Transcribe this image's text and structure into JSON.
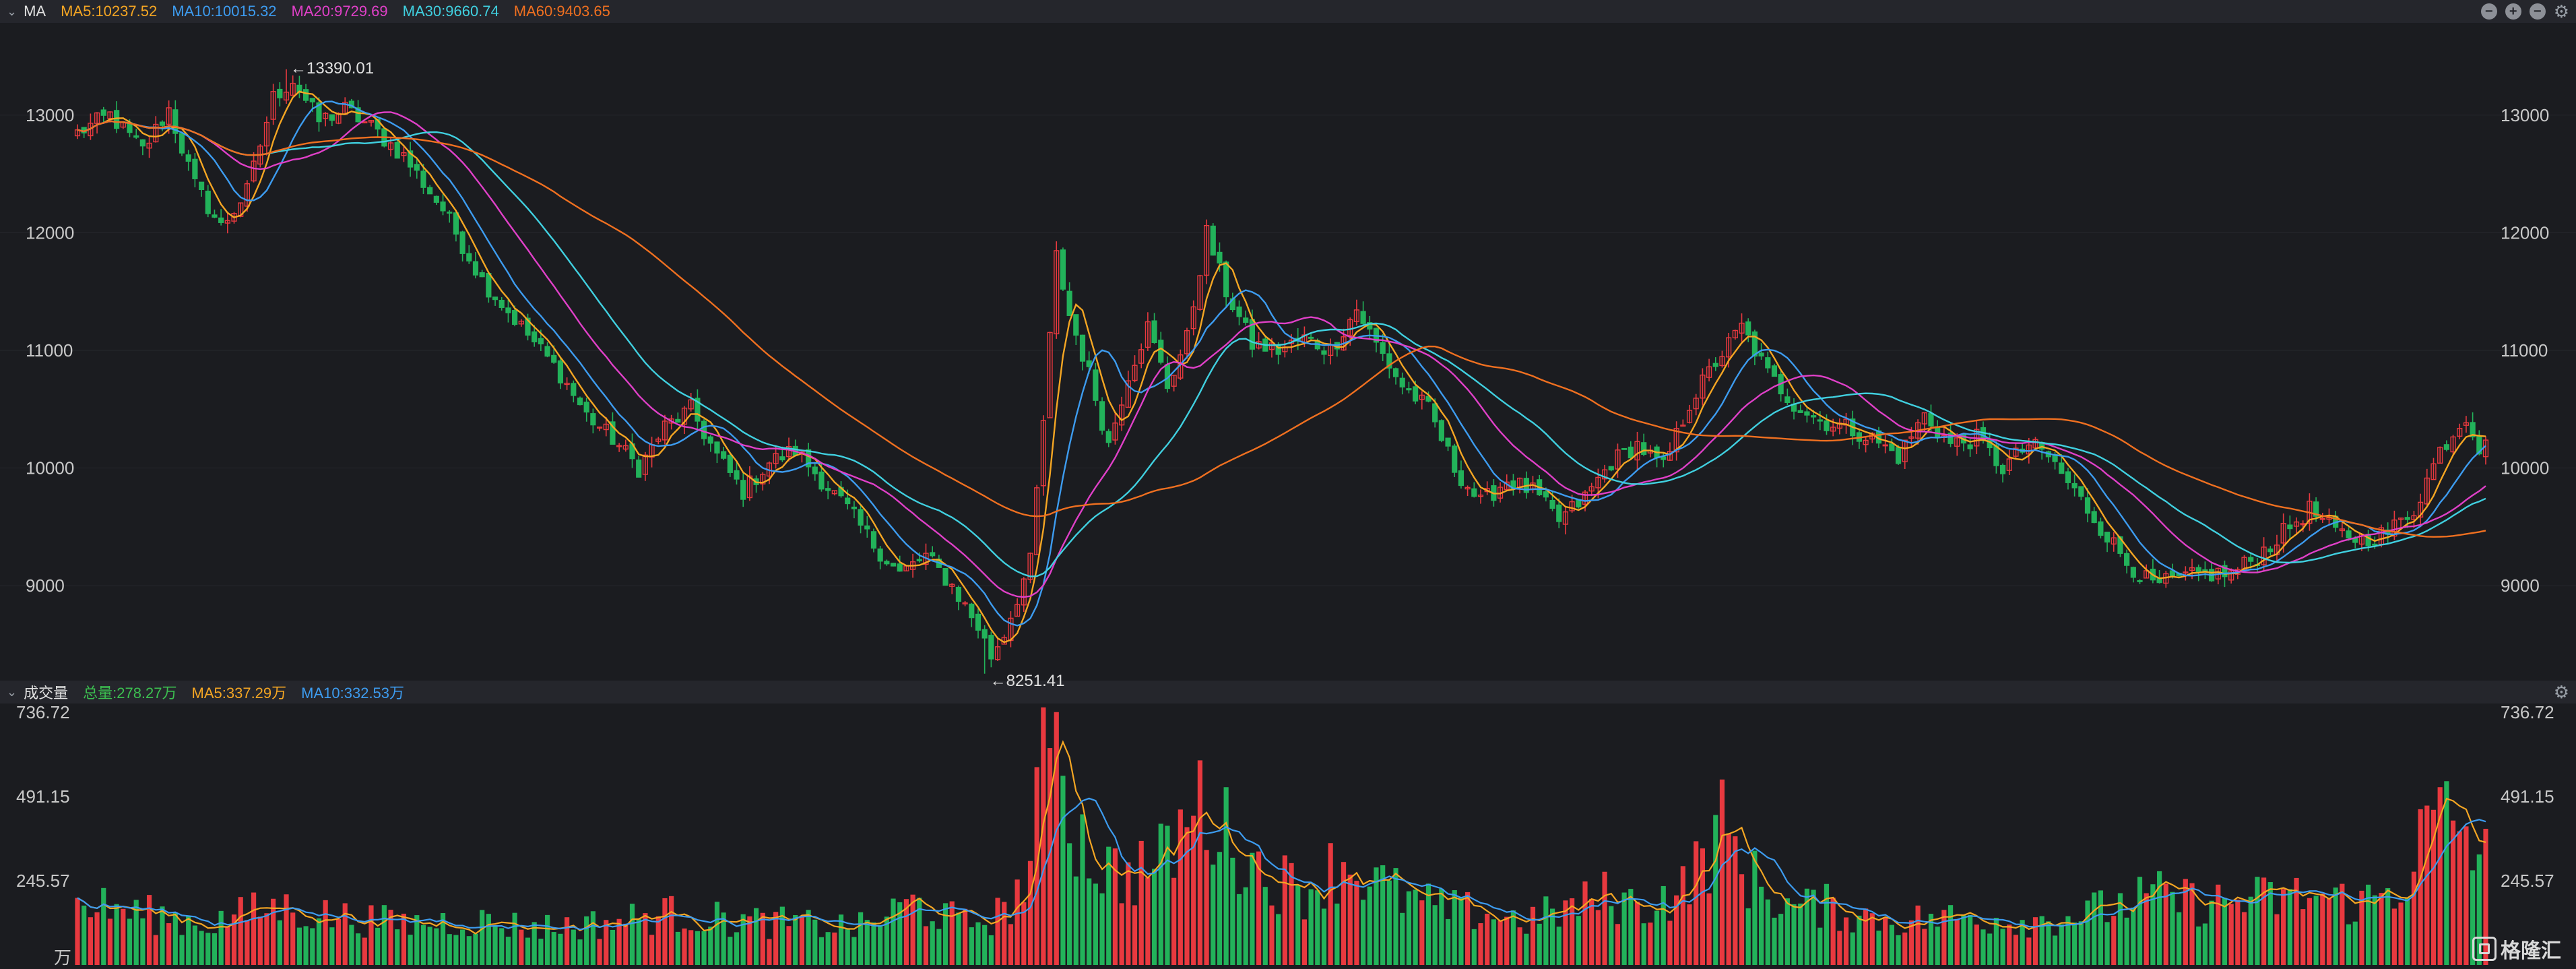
{
  "header": {
    "indicator": "MA",
    "ma5": "MA5:10237.52",
    "ma10": "MA10:10015.32",
    "ma20": "MA20:9729.69",
    "ma30": "MA30:9660.74",
    "ma60": "MA60:9403.65",
    "tools": [
      "minus-circle-icon",
      "plus-circle-icon",
      "minus-circle-icon",
      "gear-icon"
    ]
  },
  "volume_header": {
    "title": "成交量",
    "total": "总量:278.27万",
    "ma5": "MA5:337.29万",
    "ma10": "MA10:332.53万"
  },
  "colors": {
    "up": "#e8393f",
    "down": "#22b25a",
    "ma5": "#f5a623",
    "ma10": "#3d9cf0",
    "ma20": "#e040c8",
    "ma30": "#40d0e0",
    "ma60": "#f07020",
    "volume_total": "#3cc050"
  },
  "logo": {
    "text": "格隆汇"
  },
  "chart_data": [
    {
      "type": "candlestick",
      "yticks": [
        9000,
        10000,
        11000,
        12000,
        13000
      ],
      "ylim": [
        8250,
        13750
      ],
      "annotations": [
        {
          "label": "←13390.01",
          "value": 13390.01
        },
        {
          "label": "←8251.41",
          "value": 8251.41
        }
      ],
      "legend": [
        "MA5:10237.52",
        "MA10:10015.32",
        "MA20:9729.69",
        "MA30:9660.74",
        "MA60:9403.65"
      ],
      "anchors": [
        [
          0,
          12850
        ],
        [
          5,
          13000
        ],
        [
          10,
          12700
        ],
        [
          14,
          13050
        ],
        [
          18,
          12400
        ],
        [
          22,
          12050
        ],
        [
          26,
          12350
        ],
        [
          30,
          13150
        ],
        [
          33,
          13300
        ],
        [
          37,
          12950
        ],
        [
          41,
          13050
        ],
        [
          45,
          12900
        ],
        [
          50,
          12650
        ],
        [
          56,
          12200
        ],
        [
          62,
          11600
        ],
        [
          68,
          11200
        ],
        [
          74,
          10800
        ],
        [
          78,
          10450
        ],
        [
          82,
          10250
        ],
        [
          86,
          10000
        ],
        [
          90,
          10350
        ],
        [
          94,
          10500
        ],
        [
          98,
          10100
        ],
        [
          102,
          9800
        ],
        [
          106,
          10050
        ],
        [
          110,
          10150
        ],
        [
          114,
          9900
        ],
        [
          118,
          9650
        ],
        [
          122,
          9350
        ],
        [
          126,
          9100
        ],
        [
          130,
          9250
        ],
        [
          134,
          9000
        ],
        [
          138,
          8650
        ],
        [
          140,
          8400
        ],
        [
          142,
          8600
        ],
        [
          146,
          9200
        ],
        [
          148,
          10400
        ],
        [
          150,
          11800
        ],
        [
          152,
          11300
        ],
        [
          155,
          10800
        ],
        [
          158,
          10200
        ],
        [
          161,
          10800
        ],
        [
          164,
          11200
        ],
        [
          167,
          10700
        ],
        [
          170,
          11100
        ],
        [
          173,
          12000
        ],
        [
          176,
          11500
        ],
        [
          180,
          11050
        ],
        [
          184,
          11000
        ],
        [
          188,
          11100
        ],
        [
          192,
          11000
        ],
        [
          196,
          11350
        ],
        [
          199,
          11050
        ],
        [
          203,
          10700
        ],
        [
          207,
          10500
        ],
        [
          211,
          10000
        ],
        [
          215,
          9700
        ],
        [
          219,
          9900
        ],
        [
          223,
          9800
        ],
        [
          227,
          9550
        ],
        [
          231,
          9750
        ],
        [
          235,
          10050
        ],
        [
          239,
          10200
        ],
        [
          243,
          10000
        ],
        [
          247,
          10550
        ],
        [
          251,
          10900
        ],
        [
          255,
          11200
        ],
        [
          259,
          10800
        ],
        [
          263,
          10550
        ],
        [
          267,
          10400
        ],
        [
          271,
          10350
        ],
        [
          275,
          10250
        ],
        [
          279,
          10100
        ],
        [
          283,
          10450
        ],
        [
          287,
          10200
        ],
        [
          291,
          10250
        ],
        [
          295,
          10000
        ],
        [
          299,
          10200
        ],
        [
          302,
          10100
        ],
        [
          306,
          9800
        ],
        [
          310,
          9500
        ],
        [
          314,
          9200
        ],
        [
          318,
          9000
        ],
        [
          322,
          9050
        ],
        [
          326,
          9100
        ],
        [
          330,
          9100
        ],
        [
          334,
          9250
        ],
        [
          338,
          9450
        ],
        [
          342,
          9650
        ],
        [
          346,
          9450
        ],
        [
          350,
          9400
        ],
        [
          354,
          9450
        ],
        [
          358,
          9650
        ],
        [
          362,
          10150
        ],
        [
          366,
          10450
        ],
        [
          369,
          10050
        ]
      ],
      "close": 10237.52
    },
    {
      "type": "bar",
      "name": "成交量",
      "unit": "万",
      "yticks": [
        245.57,
        491.15,
        736.72
      ],
      "ylim": [
        0,
        750
      ],
      "tick_labels": [
        "736.72",
        "491.15",
        "245.57"
      ],
      "unit_label": "万",
      "vol_anchors": [
        [
          0,
          180
        ],
        [
          10,
          150
        ],
        [
          20,
          120
        ],
        [
          30,
          170
        ],
        [
          40,
          140
        ],
        [
          50,
          120
        ],
        [
          60,
          130
        ],
        [
          70,
          110
        ],
        [
          80,
          120
        ],
        [
          90,
          150
        ],
        [
          100,
          130
        ],
        [
          110,
          120
        ],
        [
          120,
          110
        ],
        [
          128,
          180
        ],
        [
          136,
          120
        ],
        [
          142,
          150
        ],
        [
          146,
          280
        ],
        [
          148,
          560
        ],
        [
          150,
          720
        ],
        [
          152,
          430
        ],
        [
          156,
          300
        ],
        [
          160,
          260
        ],
        [
          166,
          300
        ],
        [
          172,
          470
        ],
        [
          176,
          380
        ],
        [
          182,
          260
        ],
        [
          188,
          220
        ],
        [
          194,
          300
        ],
        [
          198,
          250
        ],
        [
          204,
          190
        ],
        [
          210,
          160
        ],
        [
          216,
          150
        ],
        [
          222,
          130
        ],
        [
          228,
          160
        ],
        [
          234,
          200
        ],
        [
          240,
          170
        ],
        [
          246,
          220
        ],
        [
          252,
          400
        ],
        [
          256,
          260
        ],
        [
          262,
          170
        ],
        [
          268,
          170
        ],
        [
          274,
          140
        ],
        [
          280,
          130
        ],
        [
          290,
          140
        ],
        [
          300,
          130
        ],
        [
          310,
          160
        ],
        [
          318,
          200
        ],
        [
          326,
          180
        ],
        [
          334,
          190
        ],
        [
          342,
          200
        ],
        [
          350,
          180
        ],
        [
          356,
          230
        ],
        [
          360,
          400
        ],
        [
          364,
          430
        ],
        [
          369,
          300
        ]
      ],
      "total": "278.27万"
    }
  ]
}
